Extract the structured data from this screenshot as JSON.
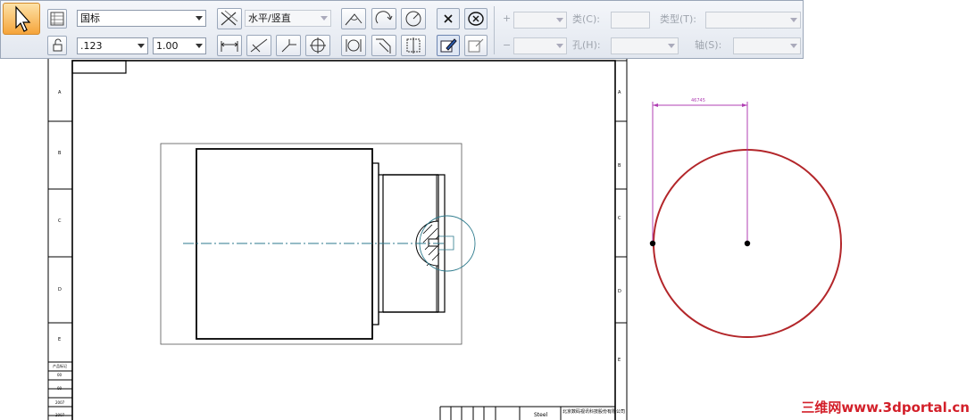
{
  "toolbar": {
    "standard_value": "国标",
    "precision_value": ".123",
    "scale_value": "1.00",
    "orientation_value": "水平/竖直",
    "plus_symbol": "+",
    "minus_symbol": "−",
    "class_label": "类(C):",
    "type_label": "类型(T):",
    "hole_label": "孔(H):",
    "shaft_label": "轴(S):",
    "close_symbol": "×"
  },
  "drawing": {
    "zones_left": [
      "A",
      "B",
      "C",
      "D",
      "E"
    ],
    "zones_right": [
      "A",
      "B",
      "C",
      "D",
      "E"
    ],
    "material": "Steel",
    "title_block_company": "北京数码视讯科技股份有限公司",
    "left_strip_labels": [
      "产品标记",
      "00",
      "00",
      "2007",
      "2007"
    ]
  },
  "detail": {
    "dimension_value": "46745"
  },
  "watermark": "三维网www.3dportal.cn",
  "colors": {
    "accent": "#f5a43a",
    "dimension": "#b03fb3",
    "circle": "#b3262a",
    "centerline": "#2c7a8c"
  }
}
